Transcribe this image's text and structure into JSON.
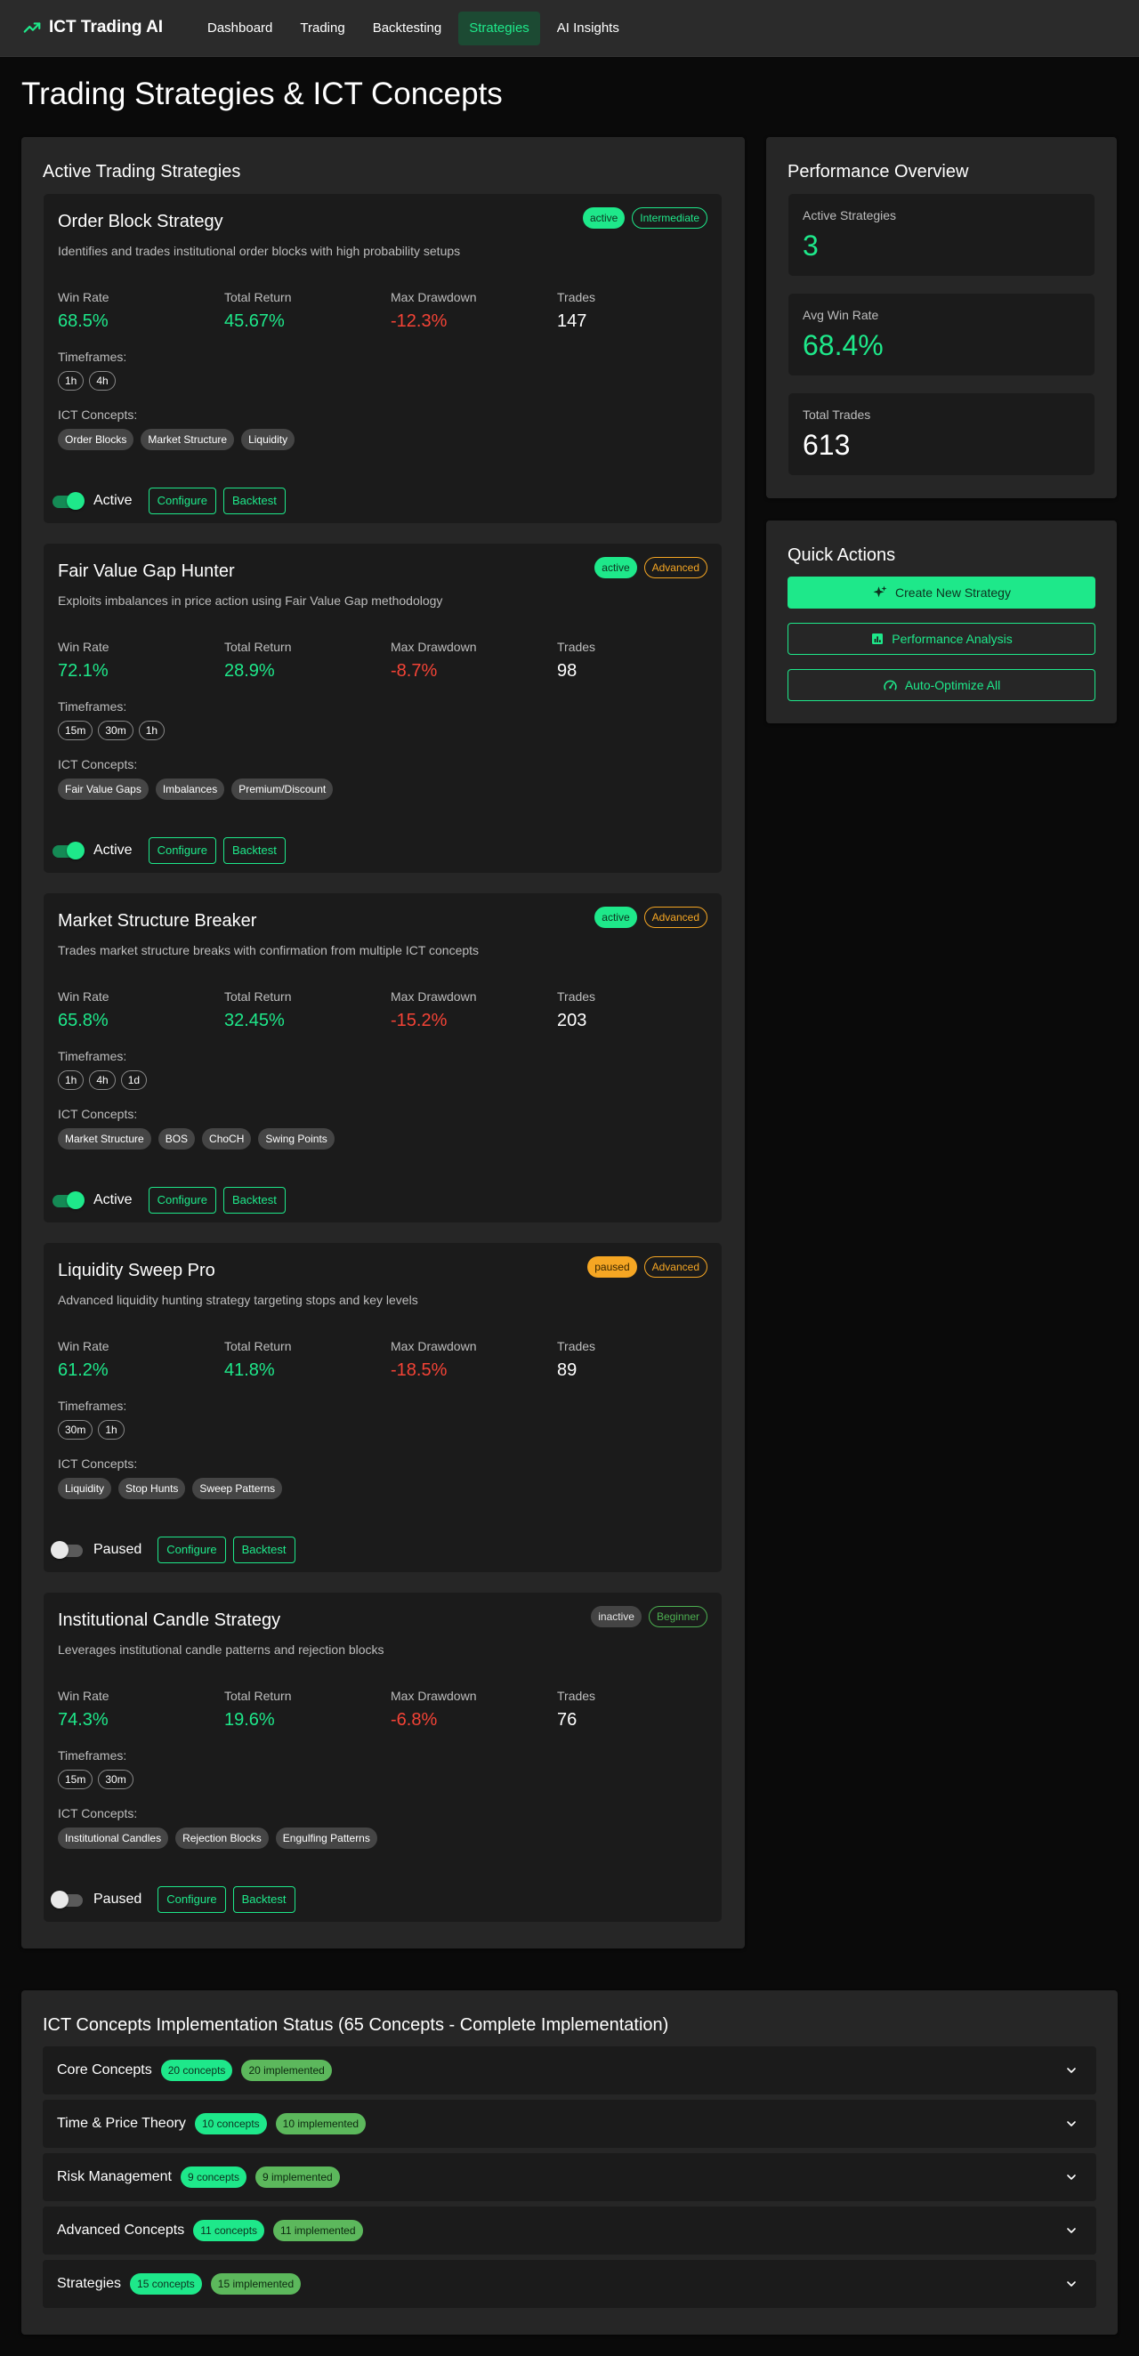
{
  "app": {
    "title": "ICT Trading AI"
  },
  "nav": [
    {
      "label": "Dashboard",
      "active": false
    },
    {
      "label": "Trading",
      "active": false
    },
    {
      "label": "Backtesting",
      "active": false
    },
    {
      "label": "Strategies",
      "active": true
    },
    {
      "label": "AI Insights",
      "active": false
    }
  ],
  "page_title": "Trading Strategies & ICT Concepts",
  "strategies_panel": {
    "title": "Active Trading Strategies",
    "stat_labels": {
      "win_rate": "Win Rate",
      "total_return": "Total Return",
      "max_drawdown": "Max Drawdown",
      "trades": "Trades"
    },
    "timeframes_label": "Timeframes:",
    "concepts_label": "ICT Concepts:",
    "configure_label": "Configure",
    "backtest_label": "Backtest",
    "strategies": [
      {
        "name": "Order Block Strategy",
        "status": "active",
        "level": "Intermediate",
        "description": "Identifies and trades institutional order blocks with high probability setups",
        "win_rate": "68.5%",
        "total_return": "45.67%",
        "max_drawdown": "-12.3%",
        "trades": "147",
        "timeframes": [
          "1h",
          "4h"
        ],
        "concepts": [
          "Order Blocks",
          "Market Structure",
          "Liquidity"
        ],
        "enabled": true,
        "toggle_label": "Active"
      },
      {
        "name": "Fair Value Gap Hunter",
        "status": "active",
        "level": "Advanced",
        "description": "Exploits imbalances in price action using Fair Value Gap methodology",
        "win_rate": "72.1%",
        "total_return": "28.9%",
        "max_drawdown": "-8.7%",
        "trades": "98",
        "timeframes": [
          "15m",
          "30m",
          "1h"
        ],
        "concepts": [
          "Fair Value Gaps",
          "Imbalances",
          "Premium/Discount"
        ],
        "enabled": true,
        "toggle_label": "Active"
      },
      {
        "name": "Market Structure Breaker",
        "status": "active",
        "level": "Advanced",
        "description": "Trades market structure breaks with confirmation from multiple ICT concepts",
        "win_rate": "65.8%",
        "total_return": "32.45%",
        "max_drawdown": "-15.2%",
        "trades": "203",
        "timeframes": [
          "1h",
          "4h",
          "1d"
        ],
        "concepts": [
          "Market Structure",
          "BOS",
          "ChoCH",
          "Swing Points"
        ],
        "enabled": true,
        "toggle_label": "Active"
      },
      {
        "name": "Liquidity Sweep Pro",
        "status": "paused",
        "level": "Advanced",
        "description": "Advanced liquidity hunting strategy targeting stops and key levels",
        "win_rate": "61.2%",
        "total_return": "41.8%",
        "max_drawdown": "-18.5%",
        "trades": "89",
        "timeframes": [
          "30m",
          "1h"
        ],
        "concepts": [
          "Liquidity",
          "Stop Hunts",
          "Sweep Patterns"
        ],
        "enabled": false,
        "toggle_label": "Paused"
      },
      {
        "name": "Institutional Candle Strategy",
        "status": "inactive",
        "level": "Beginner",
        "description": "Leverages institutional candle patterns and rejection blocks",
        "win_rate": "74.3%",
        "total_return": "19.6%",
        "max_drawdown": "-6.8%",
        "trades": "76",
        "timeframes": [
          "15m",
          "30m"
        ],
        "concepts": [
          "Institutional Candles",
          "Rejection Blocks",
          "Engulfing Patterns"
        ],
        "enabled": false,
        "toggle_label": "Paused"
      }
    ]
  },
  "performance": {
    "title": "Performance Overview",
    "cards": [
      {
        "label": "Active Strategies",
        "value": "3",
        "color": "#1ee88a"
      },
      {
        "label": "Avg Win Rate",
        "value": "68.4%",
        "color": "#1ee88a"
      },
      {
        "label": "Total Trades",
        "value": "613",
        "color": "#ffffff"
      }
    ]
  },
  "quick_actions": {
    "title": "Quick Actions",
    "buttons": [
      {
        "label": "Create New Strategy",
        "icon": "sparkle-icon",
        "style": "primary"
      },
      {
        "label": "Performance Analysis",
        "icon": "chart-icon",
        "style": "outline"
      },
      {
        "label": "Auto-Optimize All",
        "icon": "speed-icon",
        "style": "outline"
      }
    ]
  },
  "ict_status": {
    "title": "ICT Concepts Implementation Status (65 Concepts - Complete Implementation)",
    "groups": [
      {
        "name": "Core Concepts",
        "concepts": "20 concepts",
        "implemented": "20 implemented"
      },
      {
        "name": "Time & Price Theory",
        "concepts": "10 concepts",
        "implemented": "10 implemented"
      },
      {
        "name": "Risk Management",
        "concepts": "9 concepts",
        "implemented": "9 implemented"
      },
      {
        "name": "Advanced Concepts",
        "concepts": "11 concepts",
        "implemented": "11 implemented"
      },
      {
        "name": "Strategies",
        "concepts": "15 concepts",
        "implemented": "15 implemented"
      }
    ]
  },
  "colors": {
    "accent": "#1ee88a",
    "negative": "#f44336",
    "warning": "#f5a623"
  }
}
